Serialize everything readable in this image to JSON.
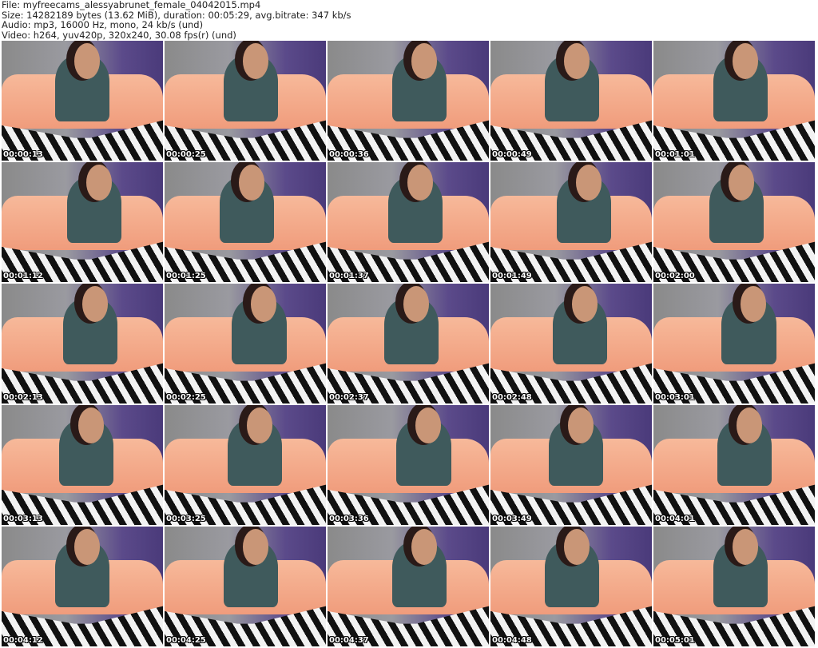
{
  "header": {
    "line1": "File: myfreecams_alessyabrunet_female_04042015.mp4",
    "line2": "Size: 14282189 bytes (13.62 MiB), duration: 00:05:29, avg.bitrate: 347 kb/s",
    "line3": "Audio: mp3, 16000 Hz, mono, 24 kb/s (und)",
    "line4": "Video: h264, yuv420p, 320x240, 30.08 fps(r) (und)"
  },
  "thumbnails": [
    "00:00:13",
    "00:00:25",
    "00:00:36",
    "00:00:49",
    "00:01:01",
    "00:01:12",
    "00:01:25",
    "00:01:37",
    "00:01:49",
    "00:02:00",
    "00:02:13",
    "00:02:25",
    "00:02:37",
    "00:02:48",
    "00:03:01",
    "00:03:13",
    "00:03:25",
    "00:03:36",
    "00:03:49",
    "00:04:01",
    "00:04:12",
    "00:04:25",
    "00:04:37",
    "00:04:48",
    "00:05:01"
  ]
}
